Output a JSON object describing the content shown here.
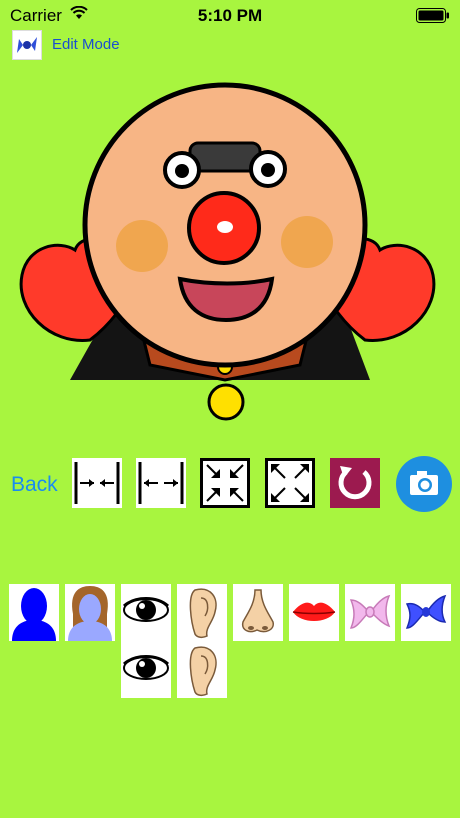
{
  "status_bar": {
    "carrier": "Carrier",
    "time": "5:10 PM"
  },
  "header": {
    "edit_mode_label": "Edit Mode",
    "edit_icon": "ribbon-bow-icon"
  },
  "toolbar": {
    "back_label": "Back",
    "tools": [
      "shrink-horizontal-icon",
      "expand-horizontal-icon",
      "shrink-icon",
      "expand-icon",
      "rotate-icon",
      "camera-icon"
    ]
  },
  "palette": [
    "face-silhouette-blue",
    "face-silhouette-with-hair",
    "eyes",
    "ears",
    "nose",
    "lips",
    "pink-bow",
    "blue-bow"
  ],
  "colors": {
    "background": "#a8f53f",
    "accent_blue": "#1a8cf0",
    "rotate_button": "#9c1a4f"
  }
}
